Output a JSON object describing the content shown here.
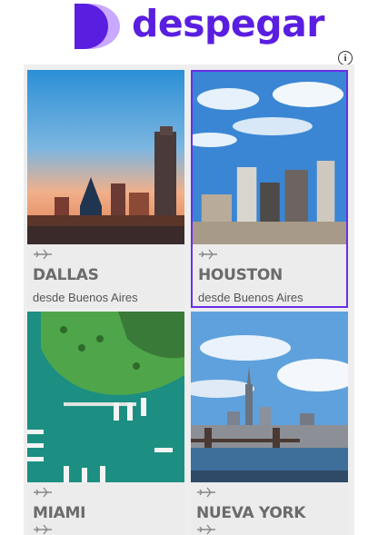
{
  "brand": {
    "name": "despegar",
    "color": "#5a1ee0",
    "logo_icon": "despegar-logo-icon"
  },
  "info_icon": "info-icon",
  "destinations": [
    {
      "city": "DALLAS",
      "subtitle": "desde Buenos Aires",
      "selected": false
    },
    {
      "city": "HOUSTON",
      "subtitle": "desde Buenos Aires",
      "selected": true
    },
    {
      "city": "MIAMI",
      "subtitle": "",
      "selected": false
    },
    {
      "city": "NUEVA YORK",
      "subtitle": "",
      "selected": false
    }
  ],
  "icons": {
    "flight": "airplane-icon"
  },
  "colors": {
    "selected_border": "#6a2ee8",
    "card_bg": "#ececec",
    "city_text": "#6b6b6b"
  }
}
